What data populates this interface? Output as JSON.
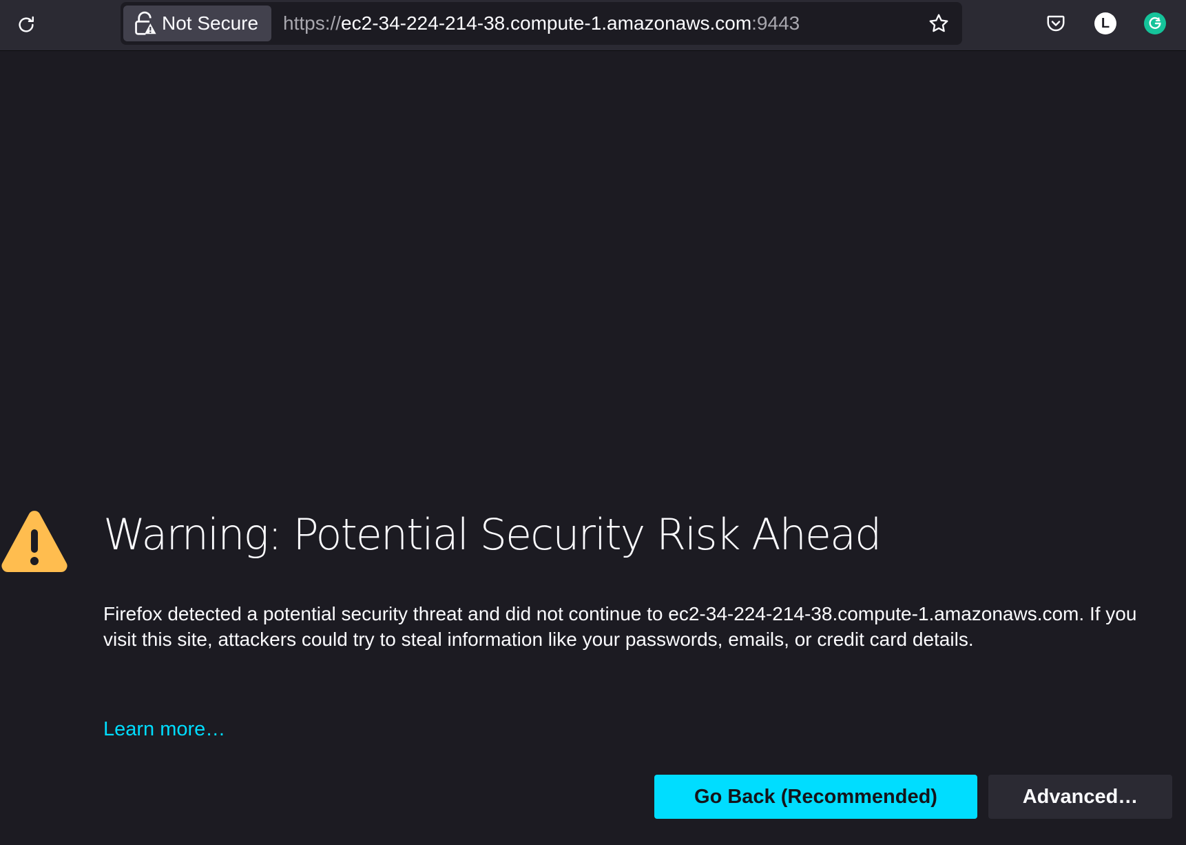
{
  "toolbar": {
    "reload_icon": "reload-icon",
    "identity_label": "Not Secure",
    "identity_icon": "insecure-lock-icon",
    "url_scheme": "https://",
    "url_host": "ec2-34-224-214-38.compute-1.amazonaws.com",
    "url_port": ":9443",
    "bookmark_icon": "star-icon",
    "pocket_icon": "pocket-icon",
    "account_initial": "L",
    "grammarly_initial": "G"
  },
  "error_page": {
    "icon": "warning-icon",
    "title": "Warning: Potential Security Risk Ahead",
    "description": "Firefox detected a potential security threat and did not continue to ec2-34-224-214-38.compute-1.amazonaws.com. If you visit this site, attackers could try to steal information like your passwords, emails, or credit card details.",
    "learn_more": "Learn more…",
    "go_back_label": "Go Back (Recommended)",
    "advanced_label": "Advanced…"
  },
  "colors": {
    "page_background": "#1c1b22",
    "toolbar_background": "#2b2a33",
    "accent": "#00ddff",
    "warning": "#ffbd4f",
    "grammarly": "#15c39a"
  }
}
